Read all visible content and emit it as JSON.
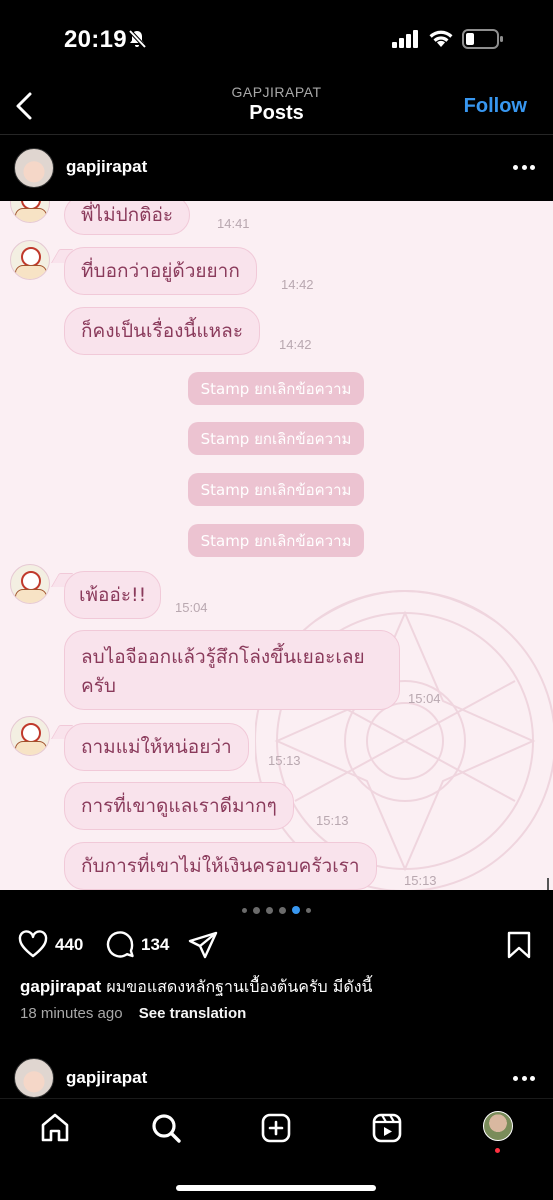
{
  "status_bar": {
    "time": "20:19",
    "icons": [
      "bell-slash-icon",
      "signal-icon",
      "wifi-icon",
      "battery-icon"
    ]
  },
  "nav": {
    "username_caption": "GAPJIRAPAT",
    "title": "Posts",
    "follow_label": "Follow",
    "back_icon": "chevron-left-icon"
  },
  "post": {
    "username": "gapjirapat",
    "chat": {
      "messages": [
        {
          "text": "พี่ไม่ปกติอ่ะ",
          "time": "14:41"
        },
        {
          "text": "ที่บอกว่าอยู่ด้วยยาก",
          "time": "14:42"
        },
        {
          "text": "ก็คงเป็นเรื่องนี้แหละ",
          "time": "14:42"
        },
        {
          "text": "เพ้ออ่ะ!!",
          "time": "15:04"
        },
        {
          "text": "ลบไอจีออกแล้วรู้สึกโล่งขึ้นเยอะเลยครับ",
          "time": "15:04"
        },
        {
          "text": "ถามแม่ให้หน่อยว่า",
          "time": "15:13"
        },
        {
          "text": "การที่เขาดูแลเราดีมากๆ",
          "time": "15:13"
        },
        {
          "text": "กับการที่เขาไม่ให้เงินครอบครัวเรา",
          "time": "15:13"
        }
      ],
      "stamps": [
        "Stamp ยกเลิกข้อความ",
        "Stamp ยกเลิกข้อความ",
        "Stamp ยกเลิกข้อความ",
        "Stamp ยกเลิกข้อความ"
      ]
    },
    "carousel": {
      "count": 6,
      "active_index": 4
    },
    "likes": "440",
    "comments": "134",
    "caption_user": "gapjirapat",
    "caption_text": "ผมขอแสดงหลักฐานเบื้องต้นครับ มีดังนี้",
    "time_ago": "18 minutes ago",
    "see_translation": "See translation"
  },
  "next_post": {
    "username": "gapjirapat"
  },
  "tab_bar": {
    "items": [
      "home-icon",
      "search-icon",
      "create-icon",
      "reels-icon",
      "profile-avatar"
    ]
  },
  "colors": {
    "accent": "#3897f0",
    "chat_bg": "#fbeff3",
    "bubble": "#f9e3ec",
    "bubble_text": "#8a3a5b",
    "stamp": "#ecc3d1",
    "notification": "#ff3040"
  }
}
